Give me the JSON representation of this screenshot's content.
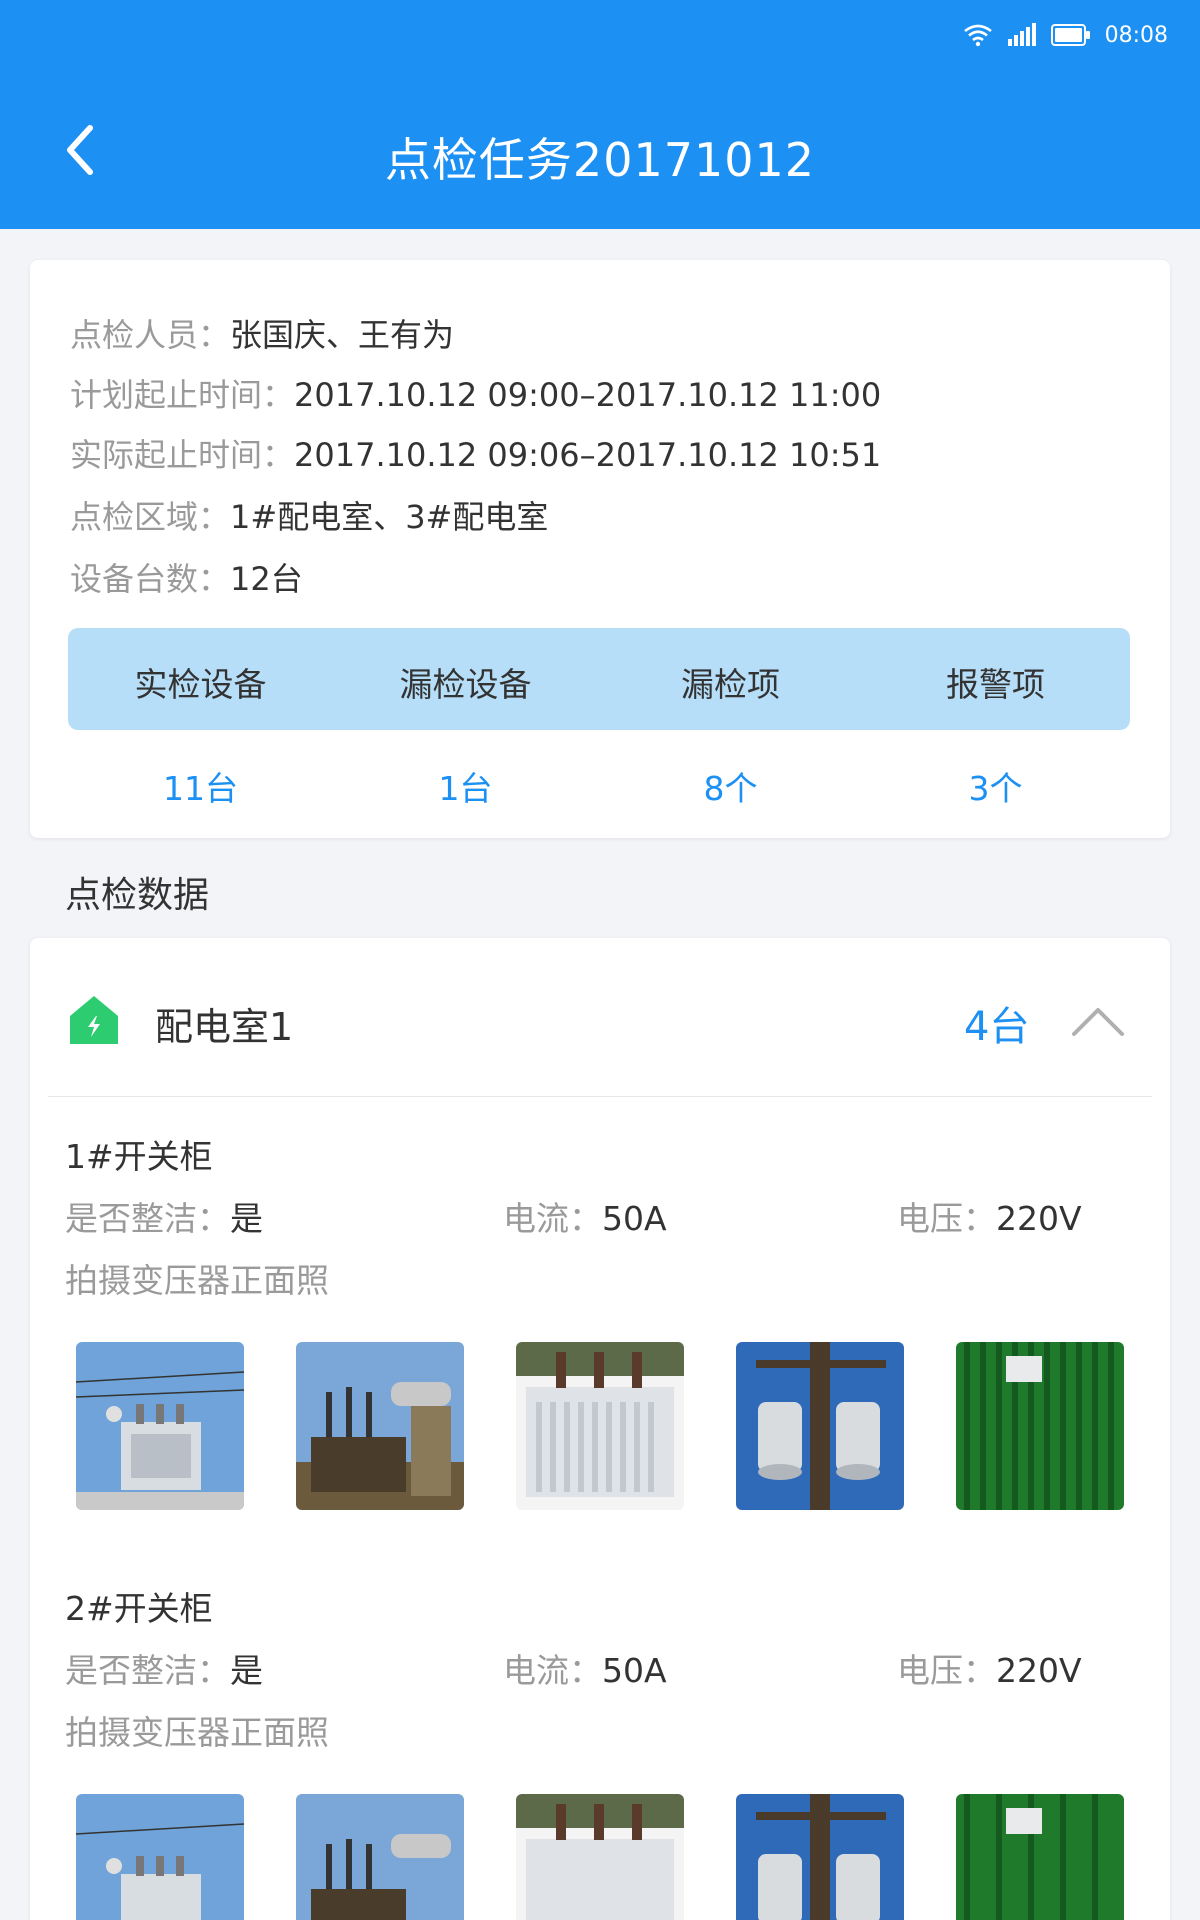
{
  "status": {
    "time": "08:08"
  },
  "header": {
    "title": "点检任务20171012"
  },
  "info": {
    "inspectors_label": "点检人员：",
    "inspectors": "张国庆、王有为",
    "planned_label": "计划起止时间：",
    "planned": "2017.10.12 09:00–2017.10.12 11:00",
    "actual_label": "实际起止时间：",
    "actual": "2017.10.12 09:06–2017.10.12 10:51",
    "area_label": "点检区域：",
    "area": "1#配电室、3#配电室",
    "count_label": "设备台数：",
    "count": "12台"
  },
  "stats": [
    {
      "label": "实检设备",
      "value": "11台"
    },
    {
      "label": "漏检设备",
      "value": "1台"
    },
    {
      "label": "漏检项",
      "value": "8个"
    },
    {
      "label": "报警项",
      "value": "3个"
    }
  ],
  "section": {
    "title": "点检数据"
  },
  "room": {
    "name": "配电室1",
    "count": "4台",
    "devices": [
      {
        "name": "1#开关柜",
        "clean_label": "是否整洁：",
        "clean": "是",
        "current_label": "电流：",
        "current": "50A",
        "voltage_label": "电压：",
        "voltage": "220V",
        "photo_hint": "拍摄变压器正面照"
      },
      {
        "name": "2#开关柜",
        "clean_label": "是否整洁：",
        "clean": "是",
        "current_label": "电流：",
        "current": "50A",
        "voltage_label": "电压：",
        "voltage": "220V",
        "photo_hint": "拍摄变压器正面照"
      }
    ]
  },
  "colors": {
    "primary": "#1c90f3",
    "stats_bg": "#b7def8",
    "room_icon": "#2ecc71"
  }
}
